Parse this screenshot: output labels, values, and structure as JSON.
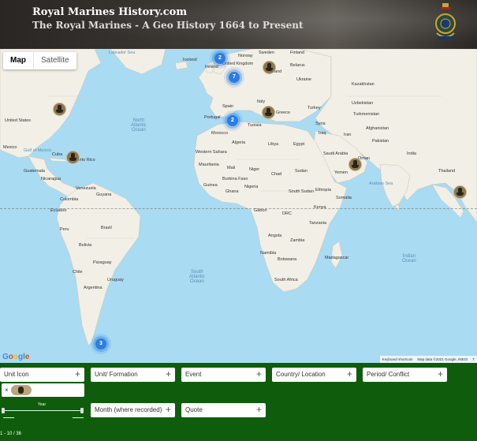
{
  "header": {
    "title": "Royal Marines History.com",
    "subtitle": "The Royal Marines - A Geo History 1664 to Present"
  },
  "map": {
    "type_buttons": [
      "Map",
      "Satellite"
    ],
    "oceans": {
      "north_atlantic": "North\nAtlantic\nOcean",
      "south_atlantic": "South\nAtlantic\nOcean",
      "indian": "Indian\nOcean"
    },
    "labels": [
      {
        "text": "Labrador Sea"
      },
      {
        "text": "Iceland"
      },
      {
        "text": "Norway"
      },
      {
        "text": "Sweden"
      },
      {
        "text": "Finland"
      },
      {
        "text": "Ireland"
      },
      {
        "text": "United Kingdom"
      },
      {
        "text": "Belarus"
      },
      {
        "text": "Poland"
      },
      {
        "text": "Ukraine"
      },
      {
        "text": "Kazakhstan"
      },
      {
        "text": "Spain"
      },
      {
        "text": "Portugal"
      },
      {
        "text": "Italy"
      },
      {
        "text": "Greece"
      },
      {
        "text": "Turkey"
      },
      {
        "text": "Uzbekistan"
      },
      {
        "text": "Turkmenistan"
      },
      {
        "text": "Afghanistan"
      },
      {
        "text": "Syria"
      },
      {
        "text": "Iraq"
      },
      {
        "text": "Iran"
      },
      {
        "text": "Pakistan"
      },
      {
        "text": "Morocco"
      },
      {
        "text": "Tunisia"
      },
      {
        "text": "Algeria"
      },
      {
        "text": "Libya"
      },
      {
        "text": "Egypt"
      },
      {
        "text": "Saudi Arabia"
      },
      {
        "text": "Oman"
      },
      {
        "text": "Yemen"
      },
      {
        "text": "India"
      },
      {
        "text": "Thailand"
      },
      {
        "text": "Western Sahara"
      },
      {
        "text": "Mauritania"
      },
      {
        "text": "Mali"
      },
      {
        "text": "Niger"
      },
      {
        "text": "Chad"
      },
      {
        "text": "Sudan"
      },
      {
        "text": "Guinea"
      },
      {
        "text": "Burkina Faso"
      },
      {
        "text": "Ghana"
      },
      {
        "text": "Nigeria"
      },
      {
        "text": "Ethiopia"
      },
      {
        "text": "South Sudan"
      },
      {
        "text": "Somalia"
      },
      {
        "text": "Kenya"
      },
      {
        "text": "Gabon"
      },
      {
        "text": "DRC"
      },
      {
        "text": "Tanzania"
      },
      {
        "text": "Angola"
      },
      {
        "text": "Zambia"
      },
      {
        "text": "Namibia"
      },
      {
        "text": "Botswana"
      },
      {
        "text": "Madagascar"
      },
      {
        "text": "South Africa"
      },
      {
        "text": "United States"
      },
      {
        "text": "Mexico"
      },
      {
        "text": "Gulf of Mexico"
      },
      {
        "text": "Cuba"
      },
      {
        "text": "Puerto Rico"
      },
      {
        "text": "Guatemala"
      },
      {
        "text": "Nicaragua"
      },
      {
        "text": "Venezuela"
      },
      {
        "text": "Colombia"
      },
      {
        "text": "Guyana"
      },
      {
        "text": "Ecuador"
      },
      {
        "text": "Peru"
      },
      {
        "text": "Brazil"
      },
      {
        "text": "Bolivia"
      },
      {
        "text": "Paraguay"
      },
      {
        "text": "Chile"
      },
      {
        "text": "Argentina"
      },
      {
        "text": "Uruguay"
      },
      {
        "text": "Arabian Sea"
      }
    ],
    "clusters": [
      {
        "count": "2"
      },
      {
        "count": "7"
      },
      {
        "count": "2"
      },
      {
        "count": "3"
      }
    ],
    "marker_count": 7,
    "google_logo": "Google",
    "attribution": [
      "Keyboard shortcuts",
      "Map data ©2021 Google, INEGI",
      "T"
    ]
  },
  "filters": {
    "unit_icon": "Unit Icon",
    "unit_formation": "Unit/ Formation",
    "event": "Event",
    "country_location": "Country/ Location",
    "period_conflict": "Period/ Conflict",
    "month": "Month (where recorded)",
    "quote": "Quote",
    "plus": "+",
    "chip_remove": "×",
    "year_label": "Year"
  },
  "counter": "1 - 10 / 36",
  "colors": {
    "panel": "#0f5d0c",
    "water": "#a9dbf3",
    "land": "#f2efe6",
    "cluster": "#2a7de1"
  }
}
